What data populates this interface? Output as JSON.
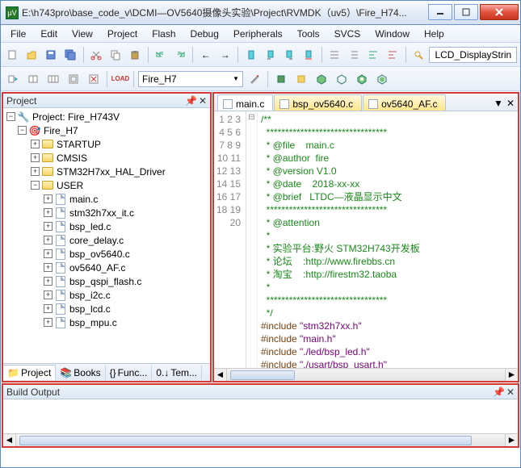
{
  "window": {
    "title": "E:\\h743pro\\base_code_v\\DCMI—OV5640摄像头实验\\Project\\RVMDK（uv5）\\Fire_H74..."
  },
  "menu": {
    "items": [
      "File",
      "Edit",
      "View",
      "Project",
      "Flash",
      "Debug",
      "Peripherals",
      "Tools",
      "SVCS",
      "Window",
      "Help"
    ]
  },
  "toolbar1": {
    "right_label": "LCD_DisplayStrin"
  },
  "toolbar2": {
    "load_label": "LOAD",
    "target": "Fire_H7"
  },
  "project_panel": {
    "title": "Project",
    "root": "Project: Fire_H743V",
    "target": "Fire_H7",
    "groups": [
      "STARTUP",
      "CMSIS",
      "STM32H7xx_HAL_Driver",
      "USER"
    ],
    "user_files": [
      "main.c",
      "stm32h7xx_it.c",
      "bsp_led.c",
      "core_delay.c",
      "bsp_ov5640.c",
      "ov5640_AF.c",
      "bsp_qspi_flash.c",
      "bsp_i2c.c",
      "bsp_lcd.c",
      "bsp_mpu.c"
    ],
    "tabs": [
      "Project",
      "Books",
      "Func...",
      "Tem..."
    ],
    "tabs_prefix": [
      "",
      "{} ",
      "0.↓"
    ]
  },
  "editor": {
    "tabs": [
      "main.c",
      "bsp_ov5640.c",
      "ov5640_AF.c"
    ],
    "lines": [
      {
        "n": 1,
        "cls": "cgrn",
        "t": "/**"
      },
      {
        "n": 2,
        "cls": "cgrn",
        "t": "  ********************************"
      },
      {
        "n": 3,
        "cls": "cgrn",
        "t": "  * @file    main.c"
      },
      {
        "n": 4,
        "cls": "cgrn",
        "t": "  * @author  fire"
      },
      {
        "n": 5,
        "cls": "cgrn",
        "t": "  * @version V1.0"
      },
      {
        "n": 6,
        "cls": "cgrn",
        "t": "  * @date    2018-xx-xx"
      },
      {
        "n": 7,
        "cls": "cgrn",
        "t": "  * @brief   LTDC—液晶显示中文"
      },
      {
        "n": 8,
        "cls": "cgrn",
        "t": "  ********************************"
      },
      {
        "n": 9,
        "cls": "cgrn",
        "t": "  * @attention"
      },
      {
        "n": 10,
        "cls": "cgrn",
        "t": "  *"
      },
      {
        "n": 11,
        "cls": "cgrn",
        "t": "  * 实验平台:野火 STM32H743开发板"
      },
      {
        "n": 12,
        "cls": "cgrn",
        "t": "  * 论坛    :http://www.firebbs.cn"
      },
      {
        "n": 13,
        "cls": "cgrn",
        "t": "  * 淘宝    :http://firestm32.taoba"
      },
      {
        "n": 14,
        "cls": "cgrn",
        "t": "  *"
      },
      {
        "n": 15,
        "cls": "cgrn",
        "t": "  ********************************"
      },
      {
        "n": 16,
        "cls": "cgrn",
        "t": "  */"
      },
      {
        "n": 17,
        "cls": "mix",
        "t": "#include \"stm32h7xx.h\""
      },
      {
        "n": 18,
        "cls": "mix",
        "t": "#include \"main.h\""
      },
      {
        "n": 19,
        "cls": "mix",
        "t": "#include \"./led/bsp_led.h\""
      },
      {
        "n": 20,
        "cls": "mix",
        "t": "#include \"./usart/bsp_usart.h\""
      }
    ]
  },
  "build": {
    "title": "Build Output"
  }
}
